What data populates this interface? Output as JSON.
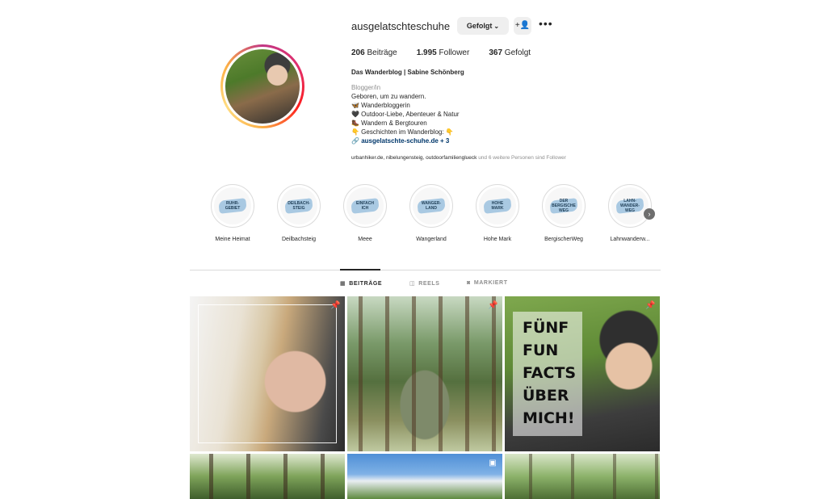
{
  "profile": {
    "username": "ausgelatschteschuhe",
    "follow_label": "Gefolgt",
    "stats": {
      "posts_count": "206",
      "posts_label": "Beiträge",
      "followers_count": "1.995",
      "followers_label": "Follower",
      "following_count": "367",
      "following_label": "Gefolgt"
    },
    "full_name": "Das Wanderblog | Sabine Schönberg",
    "category": "Blogger/in",
    "bio_lines": [
      "Geboren, um zu wandern.",
      "🦋 Wanderbloggerin",
      "🖤 Outdoor-Liebe, Abenteuer & Natur",
      "🥾 Wandern & Bergtouren",
      "👇 Geschichten im Wanderblog: 👇"
    ],
    "link_text": "ausgelatschte-schuhe.de",
    "link_more": "+ 3",
    "followed_by_names": "urbanhiker.de, nibelungensteig, outdoorfamilienglueck",
    "followed_by_rest": " und 6 weitere Personen sind Follower"
  },
  "highlights": [
    {
      "cover_text": "RUHR-\nGEBIET",
      "label": "Meine Heimat"
    },
    {
      "cover_text": "DEILBACH-\nSTEIG",
      "label": "Deilbachsteig"
    },
    {
      "cover_text": "EINFACH\nICH",
      "label": "Meee"
    },
    {
      "cover_text": "WANGER-\nLAND",
      "label": "Wangerland"
    },
    {
      "cover_text": "HOHE\nMARK",
      "label": "Hohe Mark"
    },
    {
      "cover_text": "DER\nBERGISCHE\nWEG",
      "label": "BergischerWeg"
    },
    {
      "cover_text": "LAHN-\nWANDER-\nWEG",
      "label": "Lahnwanderw..."
    }
  ],
  "tabs": {
    "posts": "BEITRÄGE",
    "reels": "REELS",
    "tagged": "MARKIERT"
  },
  "posts": {
    "facts_text": "FÜNF\nFUN\nFACTS\nÜBER\nMICH!"
  },
  "icons": {
    "follow_chevron": "chevron-down-icon",
    "suggest": "add-person-icon",
    "more": "more-options-icon",
    "link": "link-icon",
    "pin": "pin-icon",
    "reel": "reel-icon",
    "grid": "grid-icon",
    "tagged": "tagged-icon",
    "next": "chevron-right-icon"
  },
  "colors": {
    "link": "#00376b",
    "muted": "#8e8e8e",
    "button_bg": "#efefef",
    "highlight_brush": "#a9c9e2"
  }
}
